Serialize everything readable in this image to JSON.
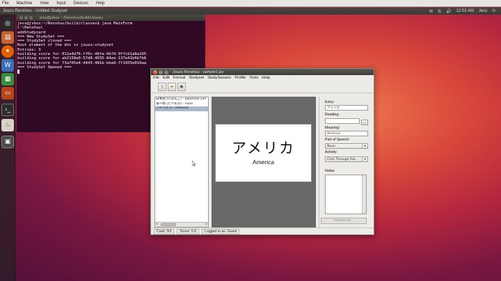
{
  "vm_menubar": {
    "items": [
      "File",
      "Machine",
      "View",
      "Input",
      "Devices",
      "Help"
    ]
  },
  "top_panel": {
    "title": "Jouzu Renshuu - Untitled Studyset",
    "user": "Jess",
    "clock": "12:02 AM"
  },
  "launcher": {
    "icons": [
      "ubuntu-home-icon",
      "files-icon",
      "firefox-icon",
      "libreoffice-writer-icon",
      "libreoffice-calc-icon",
      "libreoffice-impress-icon",
      "terminal-icon",
      "java-app-icon",
      "workspace-icon"
    ]
  },
  "terminal": {
    "title": "jess@jvbox: ~/Renshuu/build/classes",
    "lines": [
      "jess@jvbox:~/Renshuu/build/classes$ java MainForm",
      "C:\\Renshuu\\",
      "addStudycard",
      "=== New StudySet ===",
      "=== StudySet closed ===",
      "Root element of the doc is jouzu:studyset",
      "Entries: 3",
      "building score for 012a4d76-ff0c-46fa-9b7d-9ffcb1a8a165",
      "building score for ab2158e0-57d0-4935-84ee-137e41b6b7b6",
      "building score for 73a705e4-4443-481b-bba9-7f1955e010aa",
      "=== StudySet Opened ==="
    ]
  },
  "app": {
    "title": "Jouzu Renshuu - sample1.jss",
    "menu": [
      "File",
      "Edit",
      "Format",
      "Studyset",
      "StudySession",
      "Profile",
      "Tools",
      "Help"
    ],
    "cards": [
      {
        "text": "日本語 (にほんご) - Japanese Lan",
        "selected": false
      },
      {
        "text": "食べ物 (たべもの) - Food",
        "selected": false
      },
      {
        "text": "アメリカ () - America",
        "selected": true
      }
    ],
    "preview": {
      "term": "アメリカ",
      "meaning": "America"
    },
    "side": {
      "entry_label": "Entry:",
      "entry_value": "アメリカ",
      "reading_label": "Reading:",
      "reading_value": "",
      "meaning_label": "Meaning:",
      "meaning_value": "America",
      "pos_label": "Part of Speech:",
      "pos_value": "Noun",
      "activity_label": "Activity:",
      "activity_value": "Click Through Fiel...",
      "notes_label": "Notes",
      "dots_label": "...",
      "advanced_label": "Advanced..."
    },
    "status": {
      "card": "Card:   3/3",
      "score": "Score:   0.0",
      "logged": "Logged in as:   Guest"
    }
  }
}
